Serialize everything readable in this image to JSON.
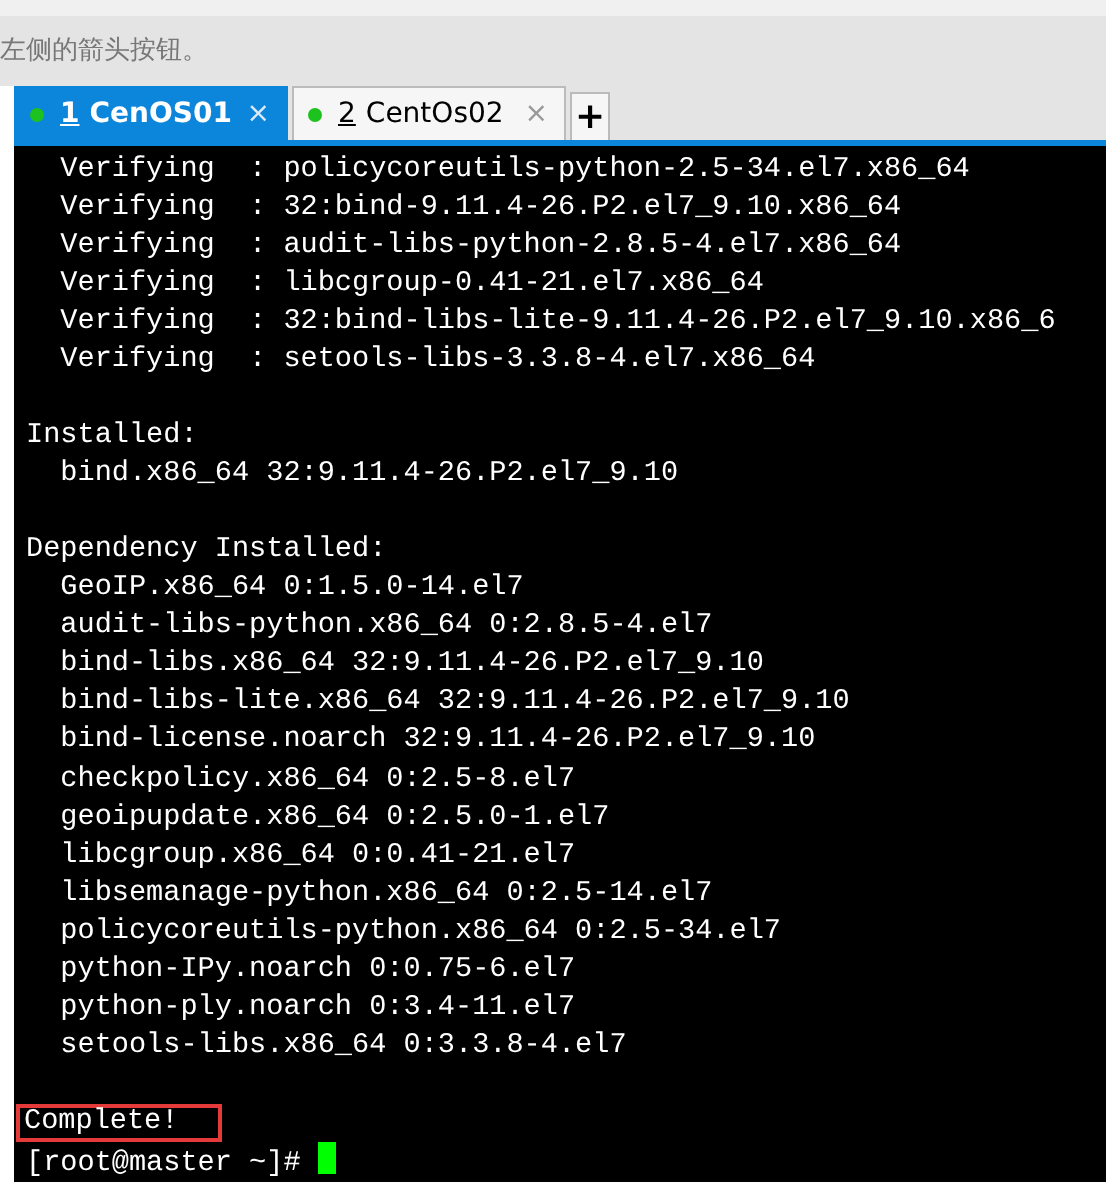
{
  "page_text": "左侧的箭头按钮。",
  "tabs": [
    {
      "number": "1",
      "label": "CenOS01",
      "close": "×",
      "selected": true,
      "connected": true
    },
    {
      "number": "2",
      "label": "CentOs02",
      "close": "×",
      "selected": false,
      "connected": true
    }
  ],
  "new_tab": "+",
  "terminal": {
    "lines": [
      {
        "text": "  Verifying  : policycoreutils-python-2.5-34.el7.x86_64",
        "highlighted": false
      },
      {
        "text": "  Verifying  : 32:bind-9.11.4-26.P2.el7_9.10.x86_64",
        "highlighted": false
      },
      {
        "text": "  Verifying  : audit-libs-python-2.8.5-4.el7.x86_64",
        "highlighted": false
      },
      {
        "text": "  Verifying  : libcgroup-0.41-21.el7.x86_64",
        "highlighted": false
      },
      {
        "text": "  Verifying  : 32:bind-libs-lite-9.11.4-26.P2.el7_9.10.x86_6",
        "highlighted": false
      },
      {
        "text": "  Verifying  : setools-libs-3.3.8-4.el7.x86_64",
        "highlighted": false
      },
      {
        "highlighted": false
      },
      {
        "text": "Installed:",
        "highlighted": false
      },
      {
        "text": "  bind.x86_64 32:9.11.4-26.P2.el7_9.10",
        "highlighted": false
      },
      {
        "highlighted": false
      },
      {
        "text": "Dependency Installed:",
        "highlighted": false
      },
      {
        "text": "  GeoIP.x86_64 0:1.5.0-14.el7",
        "highlighted": false
      },
      {
        "text": "  audit-libs-python.x86_64 0:2.8.5-4.el7",
        "highlighted": false
      },
      {
        "text": "  bind-libs.x86_64 32:9.11.4-26.P2.el7_9.10",
        "highlighted": false
      },
      {
        "text": "  bind-libs-lite.x86_64 32:9.11.4-26.P2.el7_9.10",
        "highlighted": false
      },
      {
        "text": "  bind-license.noarch 32:9.11.4-26.P2.el7_9.10",
        "highlighted": false
      },
      {
        "text": "  checkpolicy.x86_64 0:2.5-8.el7",
        "highlighted": false
      },
      {
        "text": "  geoipupdate.x86_64 0:2.5.0-1.el7",
        "highlighted": false
      },
      {
        "text": "  libcgroup.x86_64 0:0.41-21.el7",
        "highlighted": false
      },
      {
        "text": "  libsemanage-python.x86_64 0:2.5-14.el7",
        "highlighted": false
      },
      {
        "text": "  policycoreutils-python.x86_64 0:2.5-34.el7",
        "highlighted": false
      },
      {
        "text": "  python-IPy.noarch 0:0.75-6.el7",
        "highlighted": false
      },
      {
        "text": "  python-ply.noarch 0:3.4-11.el7",
        "highlighted": false
      },
      {
        "text": "  setools-libs.x86_64 0:3.3.8-4.el7",
        "highlighted": false
      },
      {
        "highlighted": false
      },
      {
        "text": "Complete!",
        "highlighted": true
      }
    ],
    "prompt": "[root@master ~]#"
  }
}
